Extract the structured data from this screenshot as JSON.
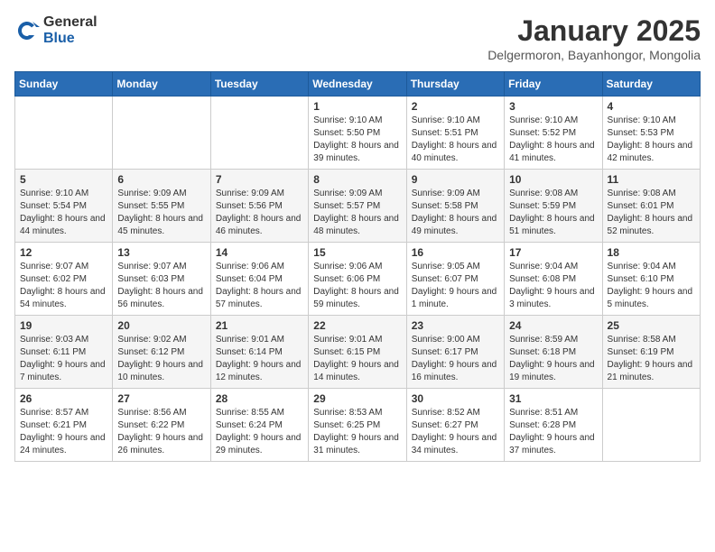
{
  "logo": {
    "general": "General",
    "blue": "Blue"
  },
  "header": {
    "month": "January 2025",
    "location": "Delgermoron, Bayanhongor, Mongolia"
  },
  "weekdays": [
    "Sunday",
    "Monday",
    "Tuesday",
    "Wednesday",
    "Thursday",
    "Friday",
    "Saturday"
  ],
  "weeks": [
    [
      {
        "day": "",
        "info": ""
      },
      {
        "day": "",
        "info": ""
      },
      {
        "day": "",
        "info": ""
      },
      {
        "day": "1",
        "info": "Sunrise: 9:10 AM\nSunset: 5:50 PM\nDaylight: 8 hours and 39 minutes."
      },
      {
        "day": "2",
        "info": "Sunrise: 9:10 AM\nSunset: 5:51 PM\nDaylight: 8 hours and 40 minutes."
      },
      {
        "day": "3",
        "info": "Sunrise: 9:10 AM\nSunset: 5:52 PM\nDaylight: 8 hours and 41 minutes."
      },
      {
        "day": "4",
        "info": "Sunrise: 9:10 AM\nSunset: 5:53 PM\nDaylight: 8 hours and 42 minutes."
      }
    ],
    [
      {
        "day": "5",
        "info": "Sunrise: 9:10 AM\nSunset: 5:54 PM\nDaylight: 8 hours and 44 minutes."
      },
      {
        "day": "6",
        "info": "Sunrise: 9:09 AM\nSunset: 5:55 PM\nDaylight: 8 hours and 45 minutes."
      },
      {
        "day": "7",
        "info": "Sunrise: 9:09 AM\nSunset: 5:56 PM\nDaylight: 8 hours and 46 minutes."
      },
      {
        "day": "8",
        "info": "Sunrise: 9:09 AM\nSunset: 5:57 PM\nDaylight: 8 hours and 48 minutes."
      },
      {
        "day": "9",
        "info": "Sunrise: 9:09 AM\nSunset: 5:58 PM\nDaylight: 8 hours and 49 minutes."
      },
      {
        "day": "10",
        "info": "Sunrise: 9:08 AM\nSunset: 5:59 PM\nDaylight: 8 hours and 51 minutes."
      },
      {
        "day": "11",
        "info": "Sunrise: 9:08 AM\nSunset: 6:01 PM\nDaylight: 8 hours and 52 minutes."
      }
    ],
    [
      {
        "day": "12",
        "info": "Sunrise: 9:07 AM\nSunset: 6:02 PM\nDaylight: 8 hours and 54 minutes."
      },
      {
        "day": "13",
        "info": "Sunrise: 9:07 AM\nSunset: 6:03 PM\nDaylight: 8 hours and 56 minutes."
      },
      {
        "day": "14",
        "info": "Sunrise: 9:06 AM\nSunset: 6:04 PM\nDaylight: 8 hours and 57 minutes."
      },
      {
        "day": "15",
        "info": "Sunrise: 9:06 AM\nSunset: 6:06 PM\nDaylight: 8 hours and 59 minutes."
      },
      {
        "day": "16",
        "info": "Sunrise: 9:05 AM\nSunset: 6:07 PM\nDaylight: 9 hours and 1 minute."
      },
      {
        "day": "17",
        "info": "Sunrise: 9:04 AM\nSunset: 6:08 PM\nDaylight: 9 hours and 3 minutes."
      },
      {
        "day": "18",
        "info": "Sunrise: 9:04 AM\nSunset: 6:10 PM\nDaylight: 9 hours and 5 minutes."
      }
    ],
    [
      {
        "day": "19",
        "info": "Sunrise: 9:03 AM\nSunset: 6:11 PM\nDaylight: 9 hours and 7 minutes."
      },
      {
        "day": "20",
        "info": "Sunrise: 9:02 AM\nSunset: 6:12 PM\nDaylight: 9 hours and 10 minutes."
      },
      {
        "day": "21",
        "info": "Sunrise: 9:01 AM\nSunset: 6:14 PM\nDaylight: 9 hours and 12 minutes."
      },
      {
        "day": "22",
        "info": "Sunrise: 9:01 AM\nSunset: 6:15 PM\nDaylight: 9 hours and 14 minutes."
      },
      {
        "day": "23",
        "info": "Sunrise: 9:00 AM\nSunset: 6:17 PM\nDaylight: 9 hours and 16 minutes."
      },
      {
        "day": "24",
        "info": "Sunrise: 8:59 AM\nSunset: 6:18 PM\nDaylight: 9 hours and 19 minutes."
      },
      {
        "day": "25",
        "info": "Sunrise: 8:58 AM\nSunset: 6:19 PM\nDaylight: 9 hours and 21 minutes."
      }
    ],
    [
      {
        "day": "26",
        "info": "Sunrise: 8:57 AM\nSunset: 6:21 PM\nDaylight: 9 hours and 24 minutes."
      },
      {
        "day": "27",
        "info": "Sunrise: 8:56 AM\nSunset: 6:22 PM\nDaylight: 9 hours and 26 minutes."
      },
      {
        "day": "28",
        "info": "Sunrise: 8:55 AM\nSunset: 6:24 PM\nDaylight: 9 hours and 29 minutes."
      },
      {
        "day": "29",
        "info": "Sunrise: 8:53 AM\nSunset: 6:25 PM\nDaylight: 9 hours and 31 minutes."
      },
      {
        "day": "30",
        "info": "Sunrise: 8:52 AM\nSunset: 6:27 PM\nDaylight: 9 hours and 34 minutes."
      },
      {
        "day": "31",
        "info": "Sunrise: 8:51 AM\nSunset: 6:28 PM\nDaylight: 9 hours and 37 minutes."
      },
      {
        "day": "",
        "info": ""
      }
    ]
  ]
}
